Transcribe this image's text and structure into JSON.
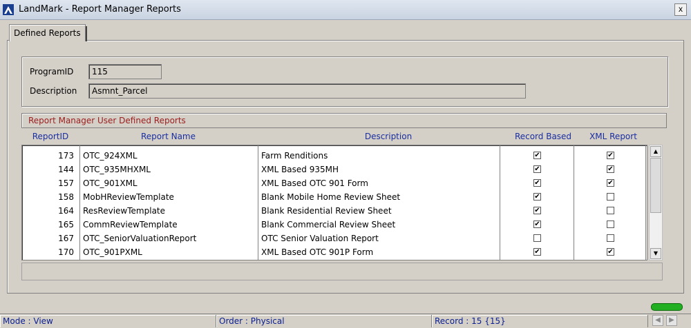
{
  "window": {
    "title": "LandMark - Report Manager Reports",
    "close_label": "x"
  },
  "tab": {
    "label": "Defined Reports"
  },
  "program": {
    "program_id_label": "ProgramID",
    "program_id_value": "115",
    "description_label": "Description",
    "description_value": "Asmnt_Parcel"
  },
  "reports": {
    "title": "Report Manager User Defined Reports",
    "columns": [
      "ReportID",
      "Report Name",
      "Description",
      "Record Based",
      "XML Report"
    ],
    "rows": [
      {
        "id": "173",
        "name": "OTC_924XML",
        "description": "Farm Renditions",
        "record_based": true,
        "xml_report": true
      },
      {
        "id": "144",
        "name": "OTC_935MHXML",
        "description": "XML Based 935MH",
        "record_based": true,
        "xml_report": true
      },
      {
        "id": "157",
        "name": "OTC_901XML",
        "description": "XML Based OTC 901 Form",
        "record_based": true,
        "xml_report": true
      },
      {
        "id": "158",
        "name": "MobHReviewTemplate",
        "description": "Blank Mobile Home Review Sheet",
        "record_based": true,
        "xml_report": false
      },
      {
        "id": "164",
        "name": "ResReviewTemplate",
        "description": "Blank Residential Review Sheet",
        "record_based": true,
        "xml_report": false
      },
      {
        "id": "165",
        "name": "CommReviewTemplate",
        "description": "Blank Commercial Review Sheet",
        "record_based": true,
        "xml_report": false
      },
      {
        "id": "167",
        "name": "OTC_SeniorValuationReport",
        "description": "OTC Senior Valuation Report",
        "record_based": false,
        "xml_report": false
      },
      {
        "id": "170",
        "name": "OTC_901PXML",
        "description": "XML Based OTC 901P Form",
        "record_based": true,
        "xml_report": true
      }
    ]
  },
  "status": {
    "mode": "Mode : View",
    "order": "Order : Physical",
    "record": "Record : 15 {15}"
  },
  "icons": {
    "app": "landmark-logo-icon",
    "check": "✔",
    "up": "▲",
    "down": "▼",
    "prev": "◀",
    "next": "▶"
  },
  "colors": {
    "title_red": "#9b1c1c",
    "header_blue": "#1a2ea0",
    "status_blue": "#0a1e8f",
    "led_green": "#22b022"
  }
}
